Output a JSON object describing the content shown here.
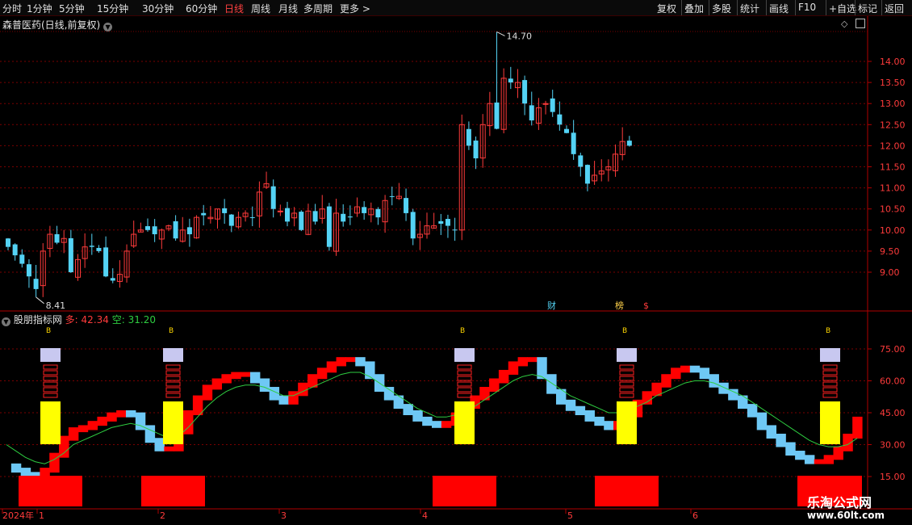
{
  "toolbar": {
    "left": [
      "分时",
      "1分钟",
      "5分钟",
      "15分钟",
      "30分钟",
      "60分钟",
      "日线",
      "周线",
      "月线",
      "多周期",
      "更多 >"
    ],
    "active": "日线",
    "right": [
      "复权",
      "叠加",
      "多股",
      "统计",
      "画线",
      "F10",
      "+自选",
      "标记",
      "返回"
    ]
  },
  "main": {
    "title": "森普医药(日线,前复权)",
    "max_label": "14.70",
    "min_label": "8.41",
    "price_ticks": [
      "14.00",
      "13.50",
      "13.00",
      "12.50",
      "12.00",
      "11.50",
      "11.00",
      "10.50",
      "10.00",
      "9.50",
      "9.00"
    ],
    "markers": [
      "财",
      "榜",
      "$"
    ],
    "colors": {
      "up": "#ff3b3b",
      "down": "#54d3f5",
      "grid": "#7a0000"
    }
  },
  "indicator": {
    "name": "股朋指标网",
    "duo_label": "多:",
    "duo_value": "42.34",
    "kong_label": "空:",
    "kong_value": "31.20",
    "ticks": [
      "75.00",
      "60.00",
      "45.00",
      "30.00",
      "15.00"
    ],
    "signal_text": "B",
    "colors": {
      "bull": "#ff0000",
      "bear": "#6ec8f5",
      "signal": "#ffff00",
      "line": "#2ecc40"
    }
  },
  "dates": {
    "labels": [
      "2024年",
      "1",
      "2",
      "3",
      "4",
      "5",
      "6"
    ]
  },
  "logo": {
    "line1": "乐淘公式网",
    "line2": "www.60lt.com"
  },
  "chart_data": [
    {
      "type": "candlestick",
      "title": "森普医药(日线,前复权)",
      "y_range": [
        8.41,
        14.7
      ],
      "y_ticks": [
        9.0,
        9.5,
        10.0,
        10.5,
        11.0,
        11.5,
        12.0,
        12.5,
        13.0,
        13.5,
        14.0
      ],
      "high": 14.7,
      "low": 8.41,
      "close": [
        9.6,
        9.4,
        9.2,
        8.9,
        8.6,
        9.5,
        9.9,
        9.7,
        9.8,
        9.0,
        9.3,
        9.6,
        9.6,
        9.5,
        8.9,
        8.8,
        8.95,
        9.5,
        9.9,
        10.0,
        10.0,
        9.9,
        10.0,
        10.1,
        9.8,
        10.0,
        9.9,
        10.3,
        10.35,
        10.3,
        10.5,
        10.4,
        10.1,
        10.3,
        10.4,
        10.3,
        10.9,
        11.1,
        10.5,
        10.45,
        10.2,
        10.4,
        10.0,
        10.45,
        10.2,
        10.5,
        9.6,
        10.4,
        10.2,
        10.3,
        10.55,
        10.4,
        10.5,
        10.3,
        10.7,
        10.8,
        10.8,
        10.4,
        9.8,
        9.9,
        10.1,
        10.1,
        10.15,
        10.1,
        10.0,
        12.5,
        12.0,
        11.7,
        12.5,
        13.0,
        12.4,
        13.6,
        13.5,
        13.5,
        13.0,
        12.6,
        12.9,
        13.0,
        12.8,
        12.5,
        12.3,
        11.8,
        11.5,
        11.1,
        11.3,
        11.4,
        11.5,
        11.8,
        12.1,
        12.0
      ]
    },
    {
      "type": "line",
      "title": "股朋指标网",
      "y_range": [
        15,
        75
      ],
      "y_ticks": [
        15,
        30,
        45,
        60,
        75
      ],
      "series": [
        {
          "name": "多",
          "last": 42.34
        },
        {
          "name": "空",
          "last": 31.2
        }
      ],
      "x": [
        1,
        2,
        3,
        4,
        5,
        6,
        7,
        8,
        9,
        10,
        11,
        12,
        13,
        14,
        15,
        16,
        17,
        18,
        19,
        20,
        21,
        22,
        23,
        24,
        25,
        26,
        27,
        28,
        29,
        30,
        31,
        32,
        33,
        34,
        35,
        36,
        37,
        38,
        39,
        40,
        41,
        42,
        43,
        44,
        45,
        46,
        47,
        48,
        49,
        50,
        51,
        52,
        53,
        54,
        55,
        56,
        57,
        58,
        59,
        60,
        61,
        62,
        63,
        64,
        65,
        66,
        67,
        68,
        69,
        70,
        71,
        72,
        73,
        74,
        75,
        76,
        77,
        78,
        79,
        80,
        81,
        82,
        83,
        84,
        85,
        86,
        87,
        88,
        89,
        90
      ],
      "main_values": [
        20,
        18,
        16,
        15,
        18,
        25,
        33,
        37,
        38,
        40,
        42,
        44,
        45,
        44,
        38,
        32,
        28,
        28,
        36,
        45,
        52,
        57,
        60,
        62,
        63,
        63,
        60,
        56,
        52,
        50,
        54,
        58,
        62,
        65,
        68,
        70,
        70,
        68,
        62,
        56,
        52,
        48,
        45,
        42,
        40,
        39,
        40,
        44,
        48,
        52,
        56,
        60,
        64,
        68,
        70,
        70,
        62,
        55,
        50,
        47,
        45,
        42,
        40,
        38,
        40,
        44,
        50,
        54,
        58,
        62,
        65,
        66,
        65,
        62,
        58,
        55,
        52,
        48,
        44,
        38,
        34,
        30,
        26,
        24,
        22,
        22,
        24,
        28,
        34,
        42
      ],
      "signal_line": [
        30,
        27,
        24,
        22,
        21,
        23,
        26,
        30,
        32,
        34,
        36,
        38,
        39,
        40,
        39,
        37,
        35,
        33,
        34,
        38,
        43,
        48,
        52,
        55,
        57,
        58,
        58,
        57,
        55,
        53,
        53,
        55,
        57,
        59,
        61,
        63,
        64,
        64,
        62,
        59,
        56,
        53,
        50,
        47,
        45,
        43,
        43,
        44,
        46,
        48,
        51,
        54,
        57,
        60,
        62,
        63,
        62,
        59,
        56,
        53,
        51,
        49,
        47,
        45,
        45,
        46,
        48,
        50,
        53,
        55,
        57,
        59,
        60,
        60,
        59,
        57,
        55,
        53,
        50,
        47,
        44,
        41,
        38,
        35,
        32,
        30,
        29,
        29,
        30,
        33
      ]
    }
  ]
}
